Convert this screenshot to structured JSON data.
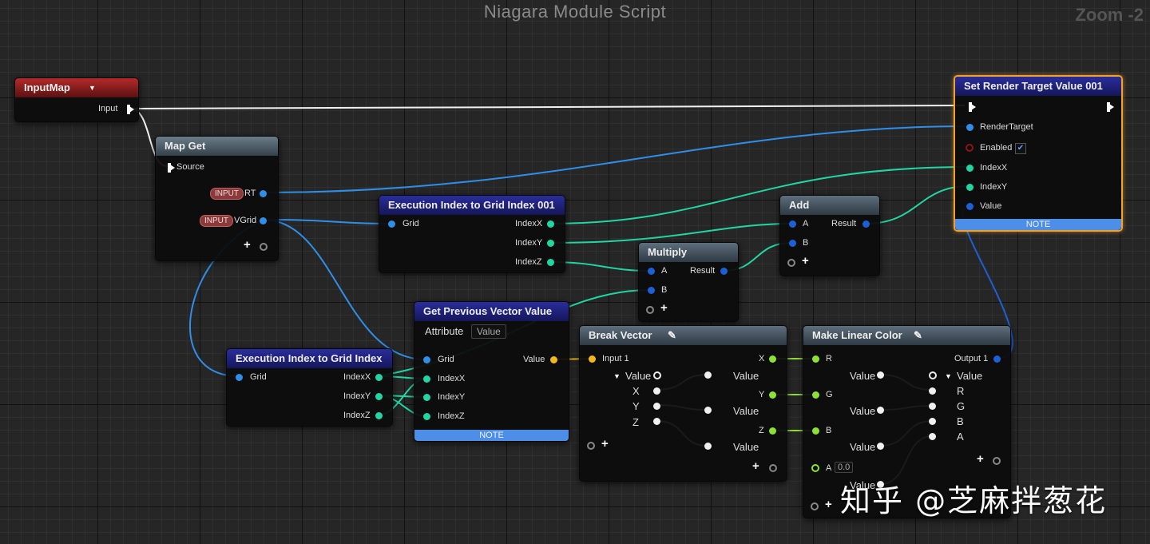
{
  "graph": {
    "title": "Niagara Module Script",
    "zoom": "Zoom -2"
  },
  "nodes": {
    "input_map": {
      "title": "InputMap",
      "input_label": "Input"
    },
    "map_get": {
      "title": "Map Get",
      "source_label": "Source",
      "rt_badge": "INPUT",
      "rt_label": "RT",
      "vgrid_badge": "INPUT",
      "vgrid_label": "VGrid"
    },
    "exec_index_001": {
      "title": "Execution Index to Grid Index 001",
      "grid_label": "Grid",
      "x_label": "IndexX",
      "y_label": "IndexY",
      "z_label": "IndexZ"
    },
    "exec_index": {
      "title": "Execution Index to Grid Index",
      "grid_label": "Grid",
      "x_label": "IndexX",
      "y_label": "IndexY",
      "z_label": "IndexZ"
    },
    "get_prev": {
      "title": "Get Previous Vector Value",
      "attribute_label": "Attribute",
      "attribute_value": "Value",
      "grid_label": "Grid",
      "x_label": "IndexX",
      "y_label": "IndexY",
      "z_label": "IndexZ",
      "value_label": "Value",
      "note": "NOTE"
    },
    "multiply": {
      "title": "Multiply",
      "a_label": "A",
      "b_label": "B",
      "result_label": "Result"
    },
    "add": {
      "title": "Add",
      "a_label": "A",
      "b_label": "B",
      "result_label": "Result"
    },
    "break_vector": {
      "title": "Break Vector",
      "input_label": "Input 1",
      "value_label": "Value",
      "x_label": "X",
      "y_label": "Y",
      "z_label": "Z",
      "out_value1": "Value",
      "out_value2": "Value",
      "out_value3": "Value",
      "out_x": "X",
      "out_y": "Y",
      "out_z": "Z"
    },
    "make_color": {
      "title": "Make Linear Color",
      "r_label": "R",
      "g_label": "G",
      "b_label": "B",
      "a_label": "A",
      "a_value": "0.0",
      "value1": "Value",
      "value2": "Value",
      "value3": "Value",
      "value4": "Value",
      "output_label": "Output 1",
      "out_value": "Value",
      "out_r": "R",
      "out_g": "G",
      "out_b": "B",
      "out_a": "A"
    },
    "set_rt": {
      "title": "Set Render Target Value 001",
      "rt_label": "RenderTarget",
      "enabled_label": "Enabled",
      "x_label": "IndexX",
      "y_label": "IndexY",
      "value_label": "Value",
      "note": "NOTE",
      "enabled_check": "✔"
    }
  },
  "watermark": "知乎 @芝麻拌葱花",
  "colors": {
    "exec": "#ffffff",
    "grid_pin": "#2f8fe8",
    "int_pin": "#21d6a2",
    "float_pin": "#1c60d8",
    "vector_pin": "#f2b818",
    "scalar_pin": "#8be233",
    "selection": "#f2a12c",
    "note_bar": "#4c8ee8"
  },
  "icons": [
    "exec-pin-icon",
    "pencil-icon",
    "add-pin-icon",
    "dropdown-arrow-icon",
    "checkbox-icon"
  ]
}
